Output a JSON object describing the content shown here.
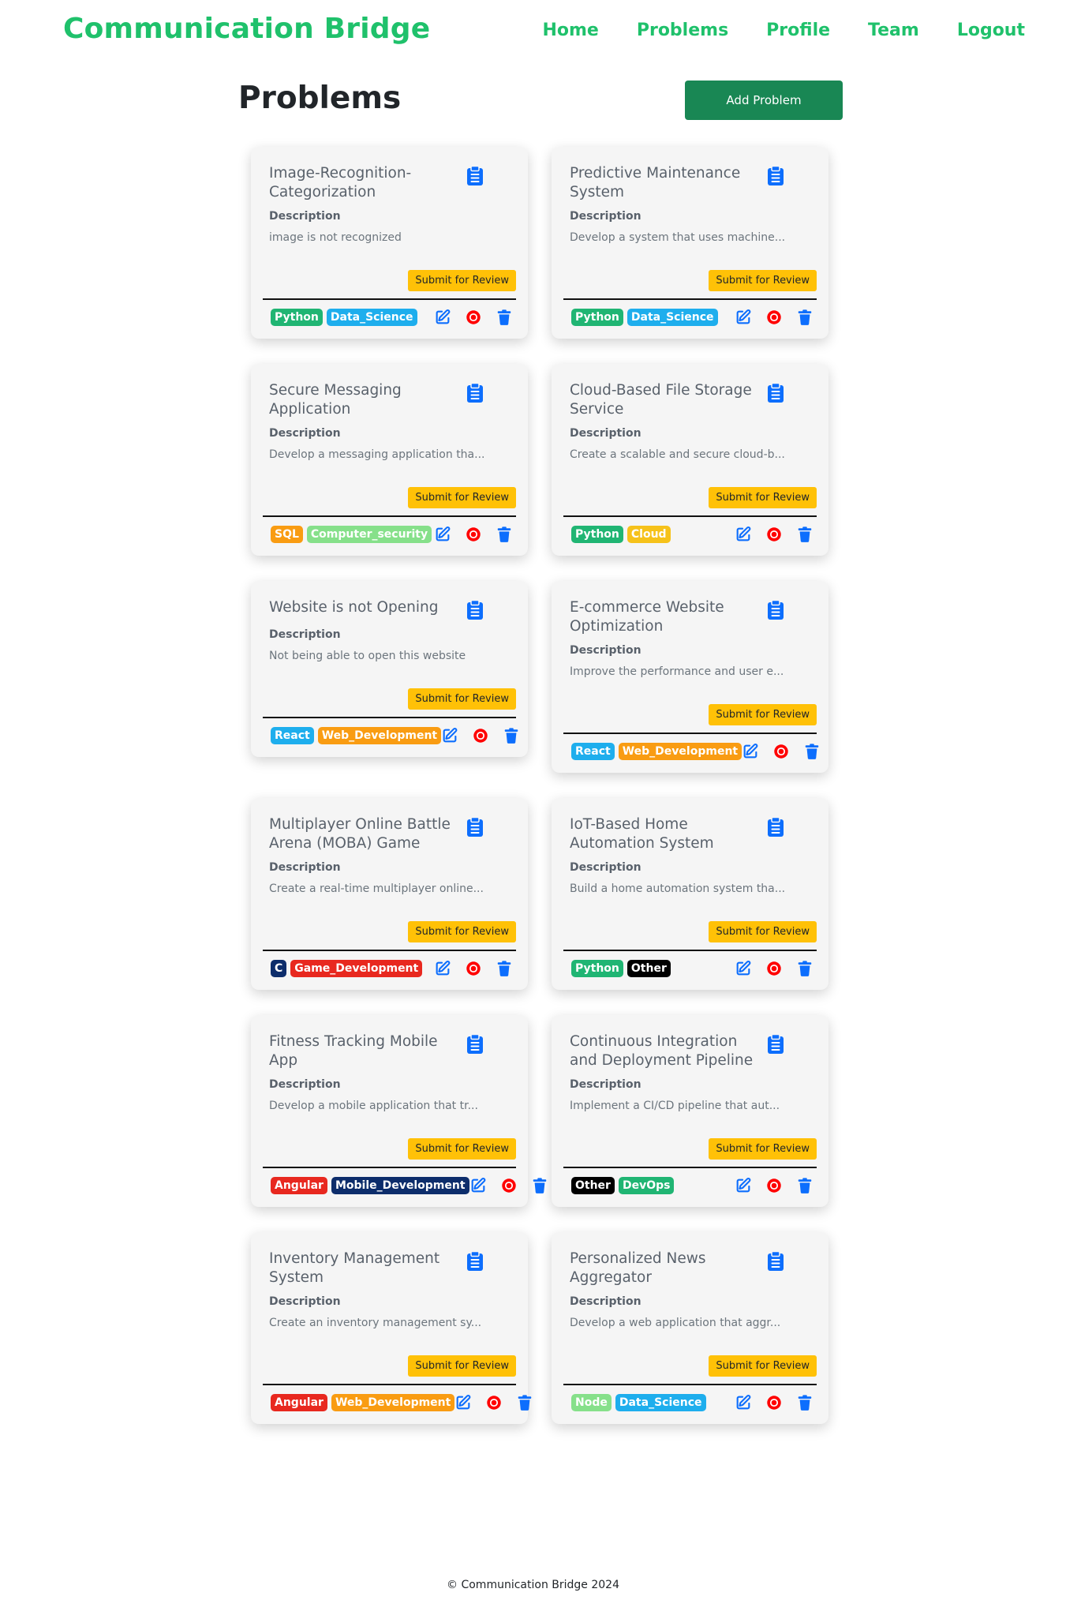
{
  "navbar": {
    "brand": "Communication Bridge",
    "links": [
      "Home",
      "Problems",
      "Profile",
      "Team",
      "Logout"
    ]
  },
  "header": {
    "title": "Problems",
    "add_label": "Add Problem"
  },
  "labels": {
    "description": "Description",
    "submit": "Submit for Review"
  },
  "colors": {
    "brand": "#1fc16b",
    "add_button": "#198754",
    "submit": "#ffc107",
    "icon_blue": "#0d6efd",
    "stop_red": "#ff0000",
    "tags": {
      "Python": "#20b573",
      "Data_Science": "#1eaeed",
      "SQL": "#f99c12",
      "Computer_security": "#86e08a",
      "Cloud": "#f6c21a",
      "React": "#1eaeed",
      "Web_Development": "#f99c12",
      "C": "#0d2d6b",
      "Game_Development": "#e8281f",
      "Other": "#000000",
      "Angular": "#e8281f",
      "Mobile_Development": "#0d2d6b",
      "DevOps": "#20b573",
      "Node": "#86e08a"
    }
  },
  "problems": [
    {
      "title": "Image-Recognition-Categorization",
      "description": "image is not recognized",
      "tags": [
        "Python",
        "Data_Science"
      ]
    },
    {
      "title": "Predictive Maintenance System",
      "description": "Develop a system that uses machine...",
      "tags": [
        "Python",
        "Data_Science"
      ]
    },
    {
      "title": "Secure Messaging Application",
      "description": "Develop a messaging application tha...",
      "tags": [
        "SQL",
        "Computer_security"
      ]
    },
    {
      "title": "Cloud-Based File Storage Service",
      "description": "Create a scalable and secure cloud-b...",
      "tags": [
        "Python",
        "Cloud"
      ]
    },
    {
      "title": "Website is not Opening",
      "description": "Not being able to open this website",
      "tags": [
        "React",
        "Web_Development"
      ]
    },
    {
      "title": "E-commerce Website Optimization",
      "description": "Improve the performance and user e...",
      "tags": [
        "React",
        "Web_Development"
      ]
    },
    {
      "title": "Multiplayer Online Battle Arena (MOBA) Game",
      "description": "Create a real-time multiplayer online...",
      "tags": [
        "C",
        "Game_Development"
      ]
    },
    {
      "title": "IoT-Based Home Automation System",
      "description": "Build a home automation system tha...",
      "tags": [
        "Python",
        "Other"
      ]
    },
    {
      "title": "Fitness Tracking Mobile App",
      "description": "Develop a mobile application that tr...",
      "tags": [
        "Angular",
        "Mobile_Development"
      ]
    },
    {
      "title": "Continuous Integration and Deployment Pipeline",
      "description": "Implement a CI/CD pipeline that aut...",
      "tags": [
        "Other",
        "DevOps"
      ]
    },
    {
      "title": "Inventory Management System",
      "description": "Create an inventory management sy...",
      "tags": [
        "Angular",
        "Web_Development"
      ]
    },
    {
      "title": "Personalized News Aggregator",
      "description": "Develop a web application that aggr...",
      "tags": [
        "Node",
        "Data_Science"
      ]
    }
  ],
  "footer": {
    "text": "© Communication Bridge 2024"
  }
}
